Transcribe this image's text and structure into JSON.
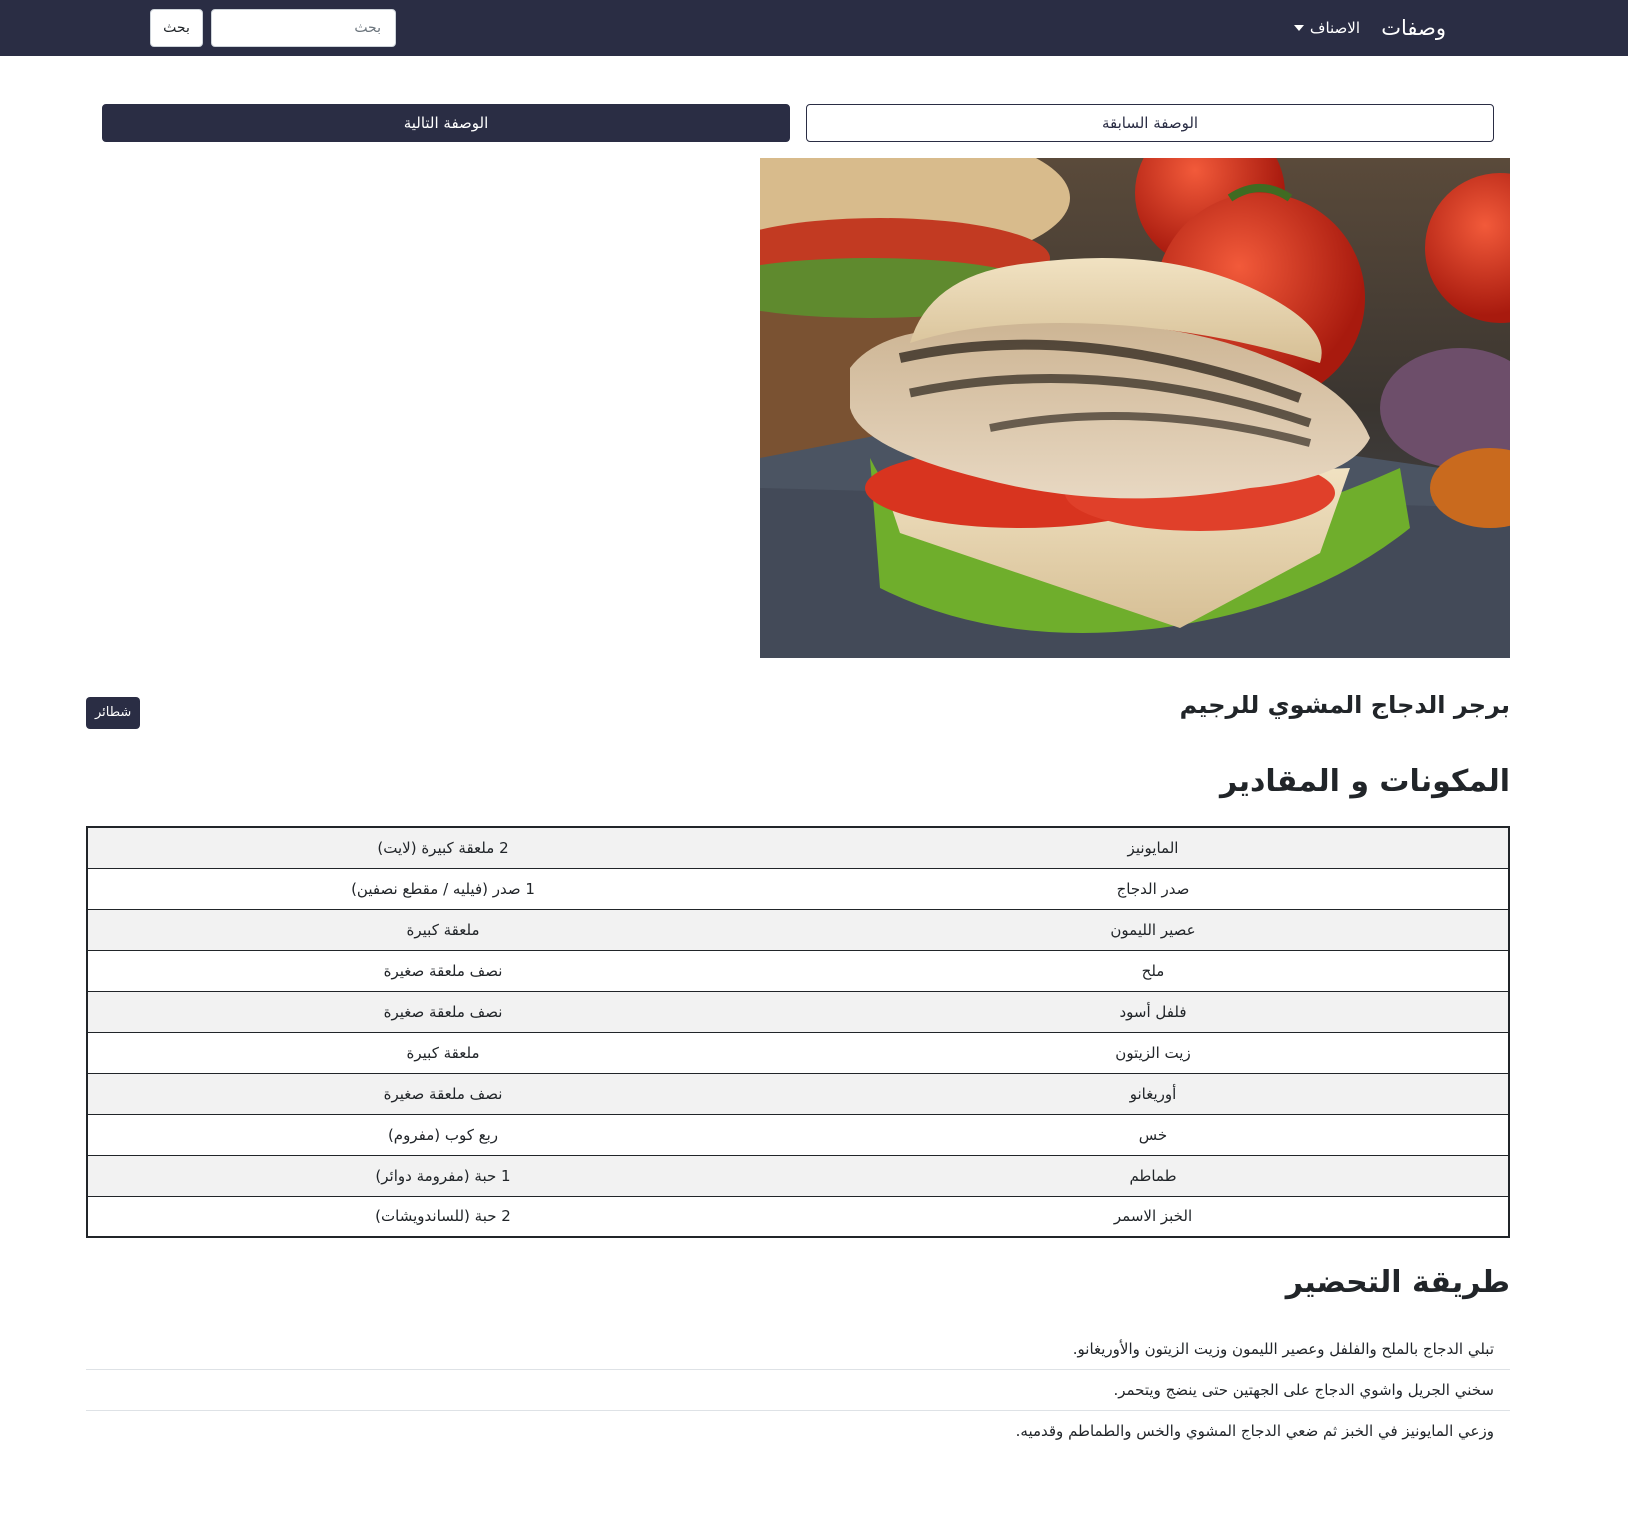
{
  "navbar": {
    "brand": "وصفات",
    "categories_label": "الاصناف",
    "search_placeholder": "بحث",
    "search_button": "بحث",
    "background_color": "#2a2d44"
  },
  "pager": {
    "next_label": "الوصفة التالية",
    "prev_label": "الوصفة السابقة"
  },
  "recipe": {
    "image_alt": "grilled chicken burger with tomato and lettuce",
    "title": "برجر الدجاج المشوي للرجيم",
    "category": "شطائر"
  },
  "ingredients": {
    "heading": "المكونات و المقادير",
    "rows": [
      {
        "name": "المايونيز",
        "amount": "2 ملعقة كبيرة (لايت)"
      },
      {
        "name": "صدر الدجاج",
        "amount": "1 صدر (فيليه / مقطع نصفين)"
      },
      {
        "name": "عصير الليمون",
        "amount": "ملعقة كبيرة"
      },
      {
        "name": "ملح",
        "amount": "نصف ملعقة صغيرة"
      },
      {
        "name": "فلفل أسود",
        "amount": "نصف ملعقة صغيرة"
      },
      {
        "name": "زيت الزيتون",
        "amount": "ملعقة كبيرة"
      },
      {
        "name": "أوريغانو",
        "amount": "نصف ملعقة صغيرة"
      },
      {
        "name": "خس",
        "amount": "ربع كوب (مفروم)"
      },
      {
        "name": "طماطم",
        "amount": "1 حبة (مفرومة دوائر)"
      },
      {
        "name": "الخبز الاسمر",
        "amount": "2 حبة (للساندويشات)"
      }
    ]
  },
  "method": {
    "heading": "طريقة التحضير",
    "steps": [
      "تبلي الدجاج بالملح والفلفل وعصير الليمون وزيت الزيتون والأوريغانو.",
      "سخني الجريل واشوي الدجاج على الجهتين حتى ينضج ويتحمر.",
      "وزعي المايونيز في الخبز ثم ضعي الدجاج المشوي والخس والطماطم وقدميه."
    ]
  }
}
